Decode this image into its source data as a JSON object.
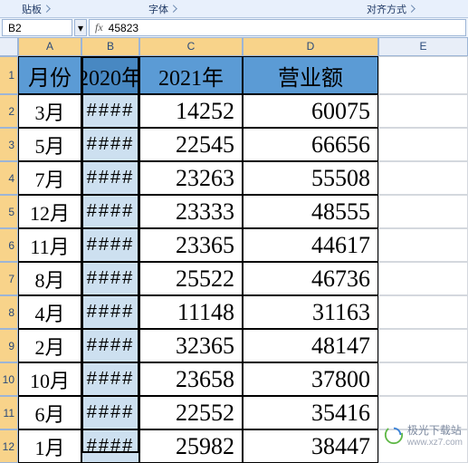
{
  "ribbon": {
    "clipboard_label": "贴板",
    "font_label": "字体",
    "align_label": "对齐方式"
  },
  "namebox": {
    "cell_ref": "B2",
    "fx_label": "fx",
    "formula_value": "45823"
  },
  "columns": [
    "A",
    "B",
    "C",
    "D",
    "E"
  ],
  "headers": {
    "a": "月份",
    "b": "2020年",
    "c": "2021年",
    "d": "营业额"
  },
  "hash": "####",
  "rows": [
    {
      "n": "2",
      "a": "3月",
      "c": "14252",
      "d": "60075"
    },
    {
      "n": "3",
      "a": "5月",
      "c": "22545",
      "d": "66656"
    },
    {
      "n": "4",
      "a": "7月",
      "c": "23263",
      "d": "55508"
    },
    {
      "n": "5",
      "a": "12月",
      "c": "23333",
      "d": "48555"
    },
    {
      "n": "6",
      "a": "11月",
      "c": "23365",
      "d": "44617"
    },
    {
      "n": "7",
      "a": "8月",
      "c": "25522",
      "d": "46736"
    },
    {
      "n": "8",
      "a": "4月",
      "c": "11148",
      "d": "31163"
    },
    {
      "n": "9",
      "a": "2月",
      "c": "32365",
      "d": "48147"
    },
    {
      "n": "10",
      "a": "10月",
      "c": "23658",
      "d": "37800"
    },
    {
      "n": "11",
      "a": "6月",
      "c": "22552",
      "d": "35416"
    },
    {
      "n": "12",
      "a": "1月",
      "c": "25982",
      "d": "38447"
    }
  ],
  "watermark": {
    "title": "极光下载站",
    "url": "www.xz7.com"
  },
  "chart_data": {
    "type": "table",
    "title": "",
    "columns": [
      "月份",
      "2020年",
      "2021年",
      "营业额"
    ],
    "note_col_b": "Column B (2020年) displays #### due to insufficient column width; active cell B2 value is 45823",
    "rows": [
      {
        "月份": "3月",
        "2021年": 14252,
        "营业额": 60075
      },
      {
        "月份": "5月",
        "2021年": 22545,
        "营业额": 66656
      },
      {
        "月份": "7月",
        "2021年": 23263,
        "营业额": 55508
      },
      {
        "月份": "12月",
        "2021年": 23333,
        "营业额": 48555
      },
      {
        "月份": "11月",
        "2021年": 23365,
        "营业额": 44617
      },
      {
        "月份": "8月",
        "2021年": 25522,
        "营业额": 46736
      },
      {
        "月份": "4月",
        "2021年": 11148,
        "营业额": 31163
      },
      {
        "月份": "2月",
        "2021年": 32365,
        "营业额": 48147
      },
      {
        "月份": "10月",
        "2021年": 23658,
        "营业额": 37800
      },
      {
        "月份": "6月",
        "2021年": 22552,
        "营业额": 35416
      },
      {
        "月份": "1月",
        "2021年": 25982,
        "营业额": 38447
      }
    ]
  }
}
